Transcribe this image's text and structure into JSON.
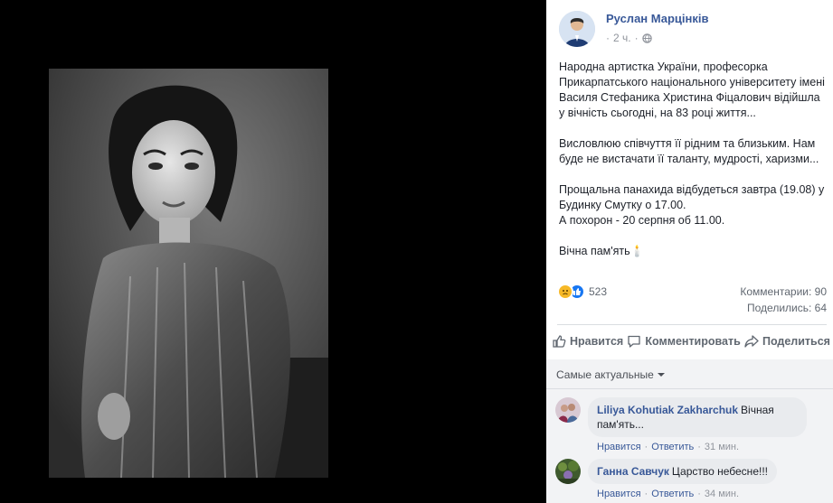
{
  "post": {
    "author": "Руслан Марцінків",
    "time": "2 ч.",
    "privacy_icon": "globe-icon",
    "paragraphs": [
      "Народна артистка України, професорка Прикарпатського національного університету імені Василя Стефаника Христина Фіцалович відійшла у вічність сьогодні, на 83 році життя...",
      "Висловлюю співчуття її рідним та близьким. Нам буде не вистачати її таланту, мудрості, харизми...",
      "Прощальна панахида відбудеться завтра (19.08) у Будинку Смутку о 17.00.\nА похорон - 20 серпня об 11.00.",
      "Вічна пам'ять🕯️"
    ]
  },
  "stats": {
    "reaction_count": "523",
    "comments": "Комментарии: 90",
    "shares": "Поделились: 64",
    "reaction_icons": [
      "sad-reaction-icon",
      "like-reaction-icon"
    ]
  },
  "actions": {
    "like": "Нравится",
    "comment": "Комментировать",
    "share": "Поделиться"
  },
  "comments_section": {
    "sort_label": "Самые актуальные",
    "items": [
      {
        "author": "Liliya Kohutiak Zakharchuk",
        "text": "Вічная пам'ять...",
        "like": "Нравится",
        "reply": "Ответить",
        "time": "31 мин."
      },
      {
        "author": "Ганна Савчук",
        "text": "Царство небесне!!!",
        "like": "Нравится",
        "reply": "Ответить",
        "time": "34 мин."
      }
    ]
  },
  "colors": {
    "link": "#385898",
    "muted": "#90949c",
    "like_blue": "#1877f2",
    "sad_yellow": "#f7b928",
    "comment_bg": "#f2f3f5"
  }
}
